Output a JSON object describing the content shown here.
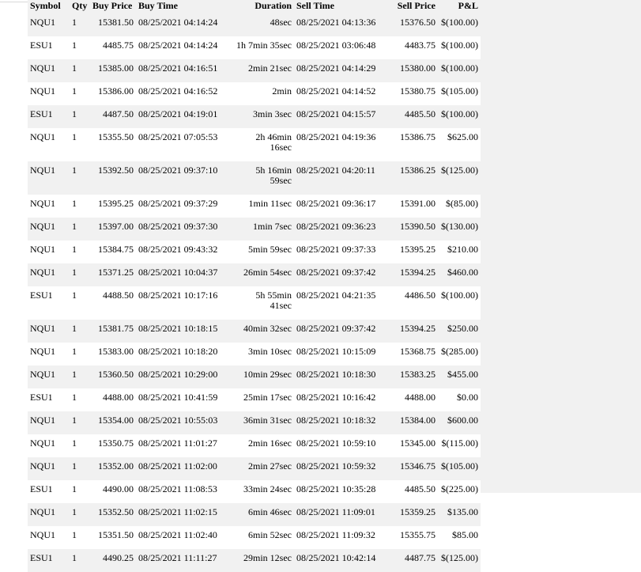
{
  "columns": {
    "symbol": "Symbol",
    "qty": "Qty",
    "buy_price": "Buy Price",
    "buy_time": "Buy Time",
    "duration": "Duration",
    "sell_time": "Sell Time",
    "sell_price": "Sell Price",
    "pnl": "P&L"
  },
  "rows": [
    {
      "symbol": "NQU1",
      "qty": "1",
      "buy_price": "15381.50",
      "buy_time": "08/25/2021 04:14:24",
      "duration": "48sec",
      "sell_time": "08/25/2021 04:13:36",
      "sell_price": "15376.50",
      "pnl": "$(100.00)"
    },
    {
      "symbol": "ESU1",
      "qty": "1",
      "buy_price": "4485.75",
      "buy_time": "08/25/2021 04:14:24",
      "duration": "1h 7min 35sec",
      "sell_time": "08/25/2021 03:06:48",
      "sell_price": "4483.75",
      "pnl": "$(100.00)"
    },
    {
      "symbol": "NQU1",
      "qty": "1",
      "buy_price": "15385.00",
      "buy_time": "08/25/2021 04:16:51",
      "duration": "2min 21sec",
      "sell_time": "08/25/2021 04:14:29",
      "sell_price": "15380.00",
      "pnl": "$(100.00)"
    },
    {
      "symbol": "NQU1",
      "qty": "1",
      "buy_price": "15386.00",
      "buy_time": "08/25/2021 04:16:52",
      "duration": "2min",
      "sell_time": "08/25/2021 04:14:52",
      "sell_price": "15380.75",
      "pnl": "$(105.00)"
    },
    {
      "symbol": "ESU1",
      "qty": "1",
      "buy_price": "4487.50",
      "buy_time": "08/25/2021 04:19:01",
      "duration": "3min 3sec",
      "sell_time": "08/25/2021 04:15:57",
      "sell_price": "4485.50",
      "pnl": "$(100.00)"
    },
    {
      "symbol": "NQU1",
      "qty": "1",
      "buy_price": "15355.50",
      "buy_time": "08/25/2021 07:05:53",
      "duration": "2h 46min 16sec",
      "sell_time": "08/25/2021 04:19:36",
      "sell_price": "15386.75",
      "pnl": "$625.00"
    },
    {
      "symbol": "NQU1",
      "qty": "1",
      "buy_price": "15392.50",
      "buy_time": "08/25/2021 09:37:10",
      "duration": "5h 16min 59sec",
      "sell_time": "08/25/2021 04:20:11",
      "sell_price": "15386.25",
      "pnl": "$(125.00)"
    },
    {
      "symbol": "NQU1",
      "qty": "1",
      "buy_price": "15395.25",
      "buy_time": "08/25/2021 09:37:29",
      "duration": "1min 11sec",
      "sell_time": "08/25/2021 09:36:17",
      "sell_price": "15391.00",
      "pnl": "$(85.00)"
    },
    {
      "symbol": "NQU1",
      "qty": "1",
      "buy_price": "15397.00",
      "buy_time": "08/25/2021 09:37:30",
      "duration": "1min 7sec",
      "sell_time": "08/25/2021 09:36:23",
      "sell_price": "15390.50",
      "pnl": "$(130.00)"
    },
    {
      "symbol": "NQU1",
      "qty": "1",
      "buy_price": "15384.75",
      "buy_time": "08/25/2021 09:43:32",
      "duration": "5min 59sec",
      "sell_time": "08/25/2021 09:37:33",
      "sell_price": "15395.25",
      "pnl": "$210.00"
    },
    {
      "symbol": "NQU1",
      "qty": "1",
      "buy_price": "15371.25",
      "buy_time": "08/25/2021 10:04:37",
      "duration": "26min 54sec",
      "sell_time": "08/25/2021 09:37:42",
      "sell_price": "15394.25",
      "pnl": "$460.00"
    },
    {
      "symbol": "ESU1",
      "qty": "1",
      "buy_price": "4488.50",
      "buy_time": "08/25/2021 10:17:16",
      "duration": "5h 55min 41sec",
      "sell_time": "08/25/2021 04:21:35",
      "sell_price": "4486.50",
      "pnl": "$(100.00)"
    },
    {
      "symbol": "NQU1",
      "qty": "1",
      "buy_price": "15381.75",
      "buy_time": "08/25/2021 10:18:15",
      "duration": "40min 32sec",
      "sell_time": "08/25/2021 09:37:42",
      "sell_price": "15394.25",
      "pnl": "$250.00"
    },
    {
      "symbol": "NQU1",
      "qty": "1",
      "buy_price": "15383.00",
      "buy_time": "08/25/2021 10:18:20",
      "duration": "3min 10sec",
      "sell_time": "08/25/2021 10:15:09",
      "sell_price": "15368.75",
      "pnl": "$(285.00)"
    },
    {
      "symbol": "NQU1",
      "qty": "1",
      "buy_price": "15360.50",
      "buy_time": "08/25/2021 10:29:00",
      "duration": "10min 29sec",
      "sell_time": "08/25/2021 10:18:30",
      "sell_price": "15383.25",
      "pnl": "$455.00"
    },
    {
      "symbol": "ESU1",
      "qty": "1",
      "buy_price": "4488.00",
      "buy_time": "08/25/2021 10:41:59",
      "duration": "25min 17sec",
      "sell_time": "08/25/2021 10:16:42",
      "sell_price": "4488.00",
      "pnl": "$0.00"
    },
    {
      "symbol": "NQU1",
      "qty": "1",
      "buy_price": "15354.00",
      "buy_time": "08/25/2021 10:55:03",
      "duration": "36min 31sec",
      "sell_time": "08/25/2021 10:18:32",
      "sell_price": "15384.00",
      "pnl": "$600.00"
    },
    {
      "symbol": "NQU1",
      "qty": "1",
      "buy_price": "15350.75",
      "buy_time": "08/25/2021 11:01:27",
      "duration": "2min 16sec",
      "sell_time": "08/25/2021 10:59:10",
      "sell_price": "15345.00",
      "pnl": "$(115.00)"
    },
    {
      "symbol": "NQU1",
      "qty": "1",
      "buy_price": "15352.00",
      "buy_time": "08/25/2021 11:02:00",
      "duration": "2min 27sec",
      "sell_time": "08/25/2021 10:59:32",
      "sell_price": "15346.75",
      "pnl": "$(105.00)"
    },
    {
      "symbol": "ESU1",
      "qty": "1",
      "buy_price": "4490.00",
      "buy_time": "08/25/2021 11:08:53",
      "duration": "33min 24sec",
      "sell_time": "08/25/2021 10:35:28",
      "sell_price": "4485.50",
      "pnl": "$(225.00)"
    },
    {
      "symbol": "NQU1",
      "qty": "1",
      "buy_price": "15352.50",
      "buy_time": "08/25/2021 11:02:15",
      "duration": "6min 46sec",
      "sell_time": "08/25/2021 11:09:01",
      "sell_price": "15359.25",
      "pnl": "$135.00"
    },
    {
      "symbol": "NQU1",
      "qty": "1",
      "buy_price": "15351.50",
      "buy_time": "08/25/2021 11:02:40",
      "duration": "6min 52sec",
      "sell_time": "08/25/2021 11:09:32",
      "sell_price": "15355.75",
      "pnl": "$85.00"
    },
    {
      "symbol": "ESU1",
      "qty": "1",
      "buy_price": "4490.25",
      "buy_time": "08/25/2021 11:11:27",
      "duration": "29min 12sec",
      "sell_time": "08/25/2021 10:42:14",
      "sell_price": "4487.75",
      "pnl": "$(125.00)"
    }
  ]
}
